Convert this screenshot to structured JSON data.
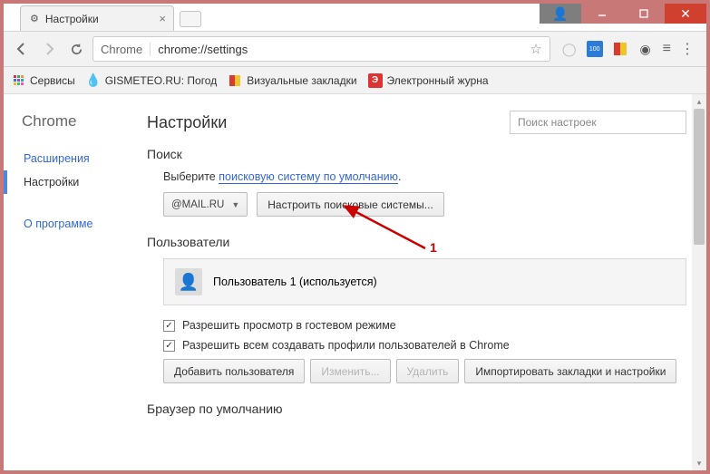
{
  "window": {
    "tab_title": "Настройки"
  },
  "urlbar": {
    "label": "Chrome",
    "url": "chrome://settings"
  },
  "bookmarks": {
    "apps": "Сервисы",
    "gismeteo": "GISMETEO.RU: Погод",
    "visual": "Визуальные закладки",
    "journal": "Электронный журна"
  },
  "sidebar": {
    "title": "Chrome",
    "extensions": "Расширения",
    "settings": "Настройки",
    "about": "О программе"
  },
  "main": {
    "title": "Настройки",
    "search_placeholder": "Поиск настроек"
  },
  "search_section": {
    "heading": "Поиск",
    "subtitle_prefix": "Выберите ",
    "subtitle_link": "поисковую систему по умолчанию",
    "dropdown": "@MAIL.RU",
    "manage_btn": "Настроить поисковые системы..."
  },
  "users_section": {
    "heading": "Пользователи",
    "current_user": "Пользователь 1 (используется)",
    "guest_checkbox": "Разрешить просмотр в гостевом режиме",
    "profile_checkbox": "Разрешить всем создавать профили пользователей в Chrome",
    "add_btn": "Добавить пользователя",
    "edit_btn": "Изменить...",
    "delete_btn": "Удалить",
    "import_btn": "Импортировать закладки и настройки"
  },
  "default_browser_section": {
    "heading": "Браузер по умолчанию"
  },
  "annotation": {
    "label": "1"
  }
}
